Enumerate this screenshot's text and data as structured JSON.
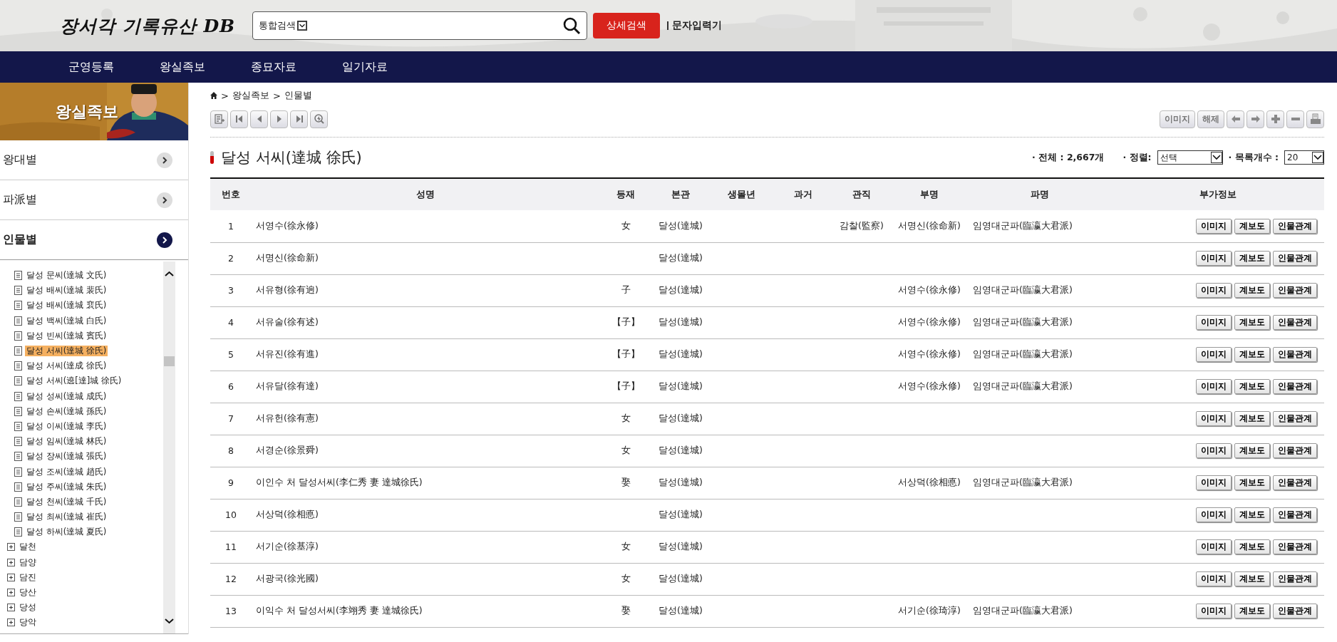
{
  "header": {
    "logo": "장서각 기록유산 DB",
    "search": {
      "scope": "통합검색"
    },
    "detail_search": "상세검색",
    "char_input": "문자입력기"
  },
  "nav": [
    "군영등록",
    "왕실족보",
    "종묘자료",
    "일기자료"
  ],
  "sidebar": {
    "banner": "왕실족보",
    "menu": [
      {
        "label": "왕대별",
        "selected": false
      },
      {
        "label": "파派별",
        "selected": false
      },
      {
        "label": "인물별",
        "selected": true
      }
    ],
    "tree": [
      {
        "children": [
          {
            "label": "달성 문씨(達城 文氏)",
            "selected": false
          },
          {
            "label": "달성 배씨(達城 裴氏)",
            "selected": false
          },
          {
            "label": "달성 배씨(達城 裵氏)",
            "selected": false
          },
          {
            "label": "달성 백씨(達城 白氏)",
            "selected": false
          },
          {
            "label": "달성 빈씨(達城 賓氏)",
            "selected": false
          },
          {
            "label": "달성 서씨(達城 徐氏)",
            "selected": true
          },
          {
            "label": "달성 서씨(達成 徐氏)",
            "selected": false
          },
          {
            "label": "달성 서씨(遶[達]城 徐氏)",
            "selected": false
          },
          {
            "label": "달성 성씨(達城 成氏)",
            "selected": false
          },
          {
            "label": "달성 손씨(達城 孫氏)",
            "selected": false
          },
          {
            "label": "달성 이씨(達城 李氏)",
            "selected": false
          },
          {
            "label": "달성 임씨(達城 林氏)",
            "selected": false
          },
          {
            "label": "달성 장씨(達城 張氏)",
            "selected": false
          },
          {
            "label": "달성 조씨(達城 趙氏)",
            "selected": false
          },
          {
            "label": "달성 주씨(達城 朱氏)",
            "selected": false
          },
          {
            "label": "달성 천씨(達城 千氏)",
            "selected": false
          },
          {
            "label": "달성 최씨(達城 崔氏)",
            "selected": false
          },
          {
            "label": "달성 하씨(達城 夏氏)",
            "selected": false
          }
        ]
      },
      {
        "label": "달천",
        "expanded": false
      },
      {
        "label": "담양",
        "expanded": false
      },
      {
        "label": "담진",
        "expanded": false
      },
      {
        "label": "당산",
        "expanded": false
      },
      {
        "label": "당성",
        "expanded": false
      },
      {
        "label": "당악",
        "expanded": false
      }
    ]
  },
  "breadcrumb": [
    {
      "separator": ">",
      "label": "왕실족보"
    },
    {
      "separator": ">",
      "label": "인물별"
    }
  ],
  "viewer_buttons": [
    "이미지",
    "해제"
  ],
  "title": "달성 서씨(達城 徐氏)",
  "summary": {
    "total": "· 전체 : 2,667개",
    "sort_label": "· 정렬:",
    "sort_value": "선택",
    "count_label": "· 목록개수 :",
    "count_value": "20"
  },
  "table": {
    "columns": [
      "번호",
      "성명",
      "등재",
      "본관",
      "생몰년",
      "과거",
      "관직",
      "부명",
      "파명",
      "부가정보"
    ],
    "rows": [
      {
        "no": "1",
        "name": "서영수(徐永修)",
        "registered": "女",
        "origin": "달성(達城)",
        "office": "감찰(監察)",
        "father": "서명신(徐命新)",
        "branch": "임영대군파(臨瀛大君派)",
        "actions": [
          "이미지",
          "계보도",
          "인물관계"
        ]
      },
      {
        "no": "2",
        "name": "서명신(徐命新)",
        "origin": "달성(達城)",
        "actions": [
          "이미지",
          "계보도",
          "인물관계"
        ]
      },
      {
        "no": "3",
        "name": "서유형(徐有逈)",
        "registered": "子",
        "origin": "달성(達城)",
        "father": "서영수(徐永修)",
        "branch": "임영대군파(臨瀛大君派)",
        "actions": [
          "이미지",
          "계보도",
          "인물관계"
        ]
      },
      {
        "no": "4",
        "name": "서유술(徐有述)",
        "registered": "【子】",
        "origin": "달성(達城)",
        "father": "서영수(徐永修)",
        "branch": "임영대군파(臨瀛大君派)",
        "actions": [
          "이미지",
          "계보도",
          "인물관계"
        ]
      },
      {
        "no": "5",
        "name": "서유진(徐有進)",
        "registered": "【子】",
        "origin": "달성(達城)",
        "father": "서영수(徐永修)",
        "branch": "임영대군파(臨瀛大君派)",
        "actions": [
          "이미지",
          "계보도",
          "인물관계"
        ]
      },
      {
        "no": "6",
        "name": "서유달(徐有達)",
        "registered": "【子】",
        "origin": "달성(達城)",
        "father": "서영수(徐永修)",
        "branch": "임영대군파(臨瀛大君派)",
        "actions": [
          "이미지",
          "계보도",
          "인물관계"
        ]
      },
      {
        "no": "7",
        "name": "서유헌(徐有憲)",
        "registered": "女",
        "origin": "달성(達城)",
        "actions": [
          "이미지",
          "계보도",
          "인물관계"
        ]
      },
      {
        "no": "8",
        "name": "서경순(徐景舜)",
        "registered": "女",
        "origin": "달성(達城)",
        "actions": [
          "이미지",
          "계보도",
          "인물관계"
        ]
      },
      {
        "no": "9",
        "name": "이인수 처 달성서씨(李仁秀 妻 達城徐氏)",
        "registered": "娶",
        "origin": "달성(達城)",
        "father": "서상덕(徐相悳)",
        "branch": "임영대군파(臨瀛大君派)",
        "actions": [
          "이미지",
          "계보도",
          "인물관계"
        ]
      },
      {
        "no": "10",
        "name": "서상덕(徐相悳)",
        "origin": "달성(達城)",
        "actions": [
          "이미지",
          "계보도",
          "인물관계"
        ]
      },
      {
        "no": "11",
        "name": "서기순(徐基淳)",
        "registered": "女",
        "origin": "달성(達城)",
        "actions": [
          "이미지",
          "계보도",
          "인물관계"
        ]
      },
      {
        "no": "12",
        "name": "서광국(徐光國)",
        "registered": "女",
        "origin": "달성(達城)",
        "actions": [
          "이미지",
          "계보도",
          "인물관계"
        ]
      },
      {
        "no": "13",
        "name": "이익수 처 달성서씨(李翊秀 妻 達城徐氏)",
        "registered": "娶",
        "origin": "달성(達城)",
        "father": "서기순(徐琦淳)",
        "branch": "임영대군파(臨瀛大君派)",
        "actions": [
          "이미지",
          "계보도",
          "인물관계"
        ]
      }
    ]
  }
}
